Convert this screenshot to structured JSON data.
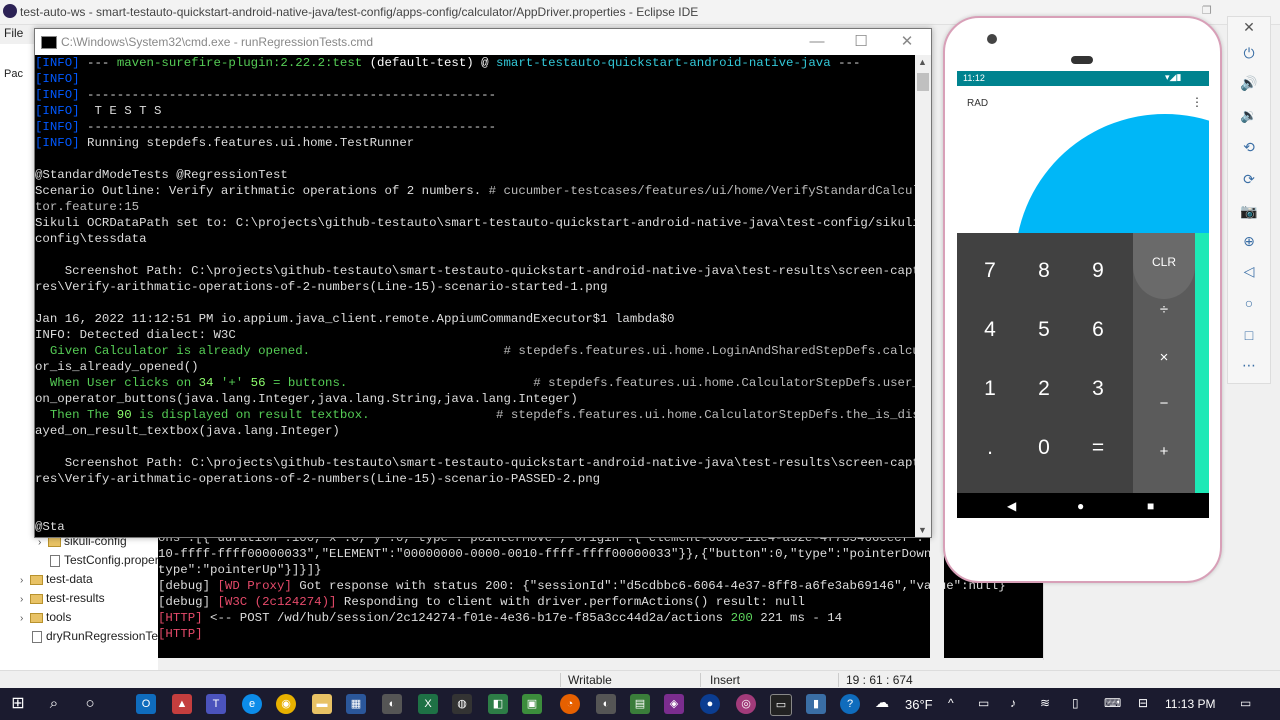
{
  "eclipse": {
    "title": "test-auto-ws - smart-testauto-quickstart-android-native-java/test-config/apps-config/calculator/AppDriver.properties - Eclipse IDE",
    "menu_file": "File",
    "panel_label": "Pac",
    "tree": [
      {
        "label": "sikuli-config",
        "type": "folder"
      },
      {
        "label": "TestConfig.proper",
        "type": "file"
      },
      {
        "label": "test-data",
        "type": "folder"
      },
      {
        "label": "test-results",
        "type": "folder"
      },
      {
        "label": "tools",
        "type": "folder"
      },
      {
        "label": "dryRunRegressionTes",
        "type": "file"
      }
    ],
    "console_lines": [
      {
        "text": "ons\":[{\"duration\":100,\"x\":0,\"y\":0,\"type\":\"pointerMove\",\"origin\":{\"element-6066-11e4-a52e-4f735466cecf\":\"000"
      },
      {
        "text": "10-ffff-ffff00000033\",\"ELEMENT\":\"00000000-0000-0010-ffff-ffff00000033\"}},{\"button\":0,\"type\":\"pointerDown\"},"
      },
      {
        "text": "type\":\"pointerUp\"}]}]}"
      }
    ],
    "log_lines": [
      {
        "tag": "[WD Proxy]",
        "msg": " Got response with status 200: {\"sessionId\":\"d5cdbbc6-6064-4e37-8ff8-a6fe3ab69146\",\"value\":null}"
      },
      {
        "tag": "[W3C (2c124274)]",
        "msg": " Responding to client with driver.performActions() result: null"
      }
    ],
    "debug_prefix": "[debug] ",
    "http_tag": "[HTTP]",
    "http_line": " <-- POST /wd/hub/session/2c124274-f01e-4e36-b17e-f85a3cc44d2a/actions ",
    "http_status": "200",
    "http_tail": " 221 ms - 14",
    "http_tag2": "[HTTP]",
    "status_writable": "Writable",
    "status_insert": "Insert",
    "status_pos": "19 : 61 : 674"
  },
  "cmd": {
    "title": "C:\\Windows\\System32\\cmd.exe - runRegressionTests.cmd",
    "info_tag": "[INFO]",
    "l1_a": " --- ",
    "l1_plugin": "maven-surefire-plugin:2.22.2:test",
    "l1_b": " (default-test) @ ",
    "l1_proj": "smart-testauto-quickstart-android-native-java",
    "l1_c": " ---",
    "dashes": " -------------------------------------------------------",
    "tests": "  T E S T S",
    "running": " Running stepdefs.features.ui.home.TestRunner",
    "tags": "@StandardModeTests @RegressionTest",
    "scenario_a": "Scenario Outline: Verify arithmatic operations of 2 numbers.",
    "scenario_b": " # cucumber-testcases/features/ui/home/VerifyStandardCalcula",
    "scenario_c": "tor.feature:15",
    "sikuli_a": "Sikuli OCRDataPath set to: C:\\projects\\github-testauto\\smart-testauto-quickstart-android-native-java\\test-config/sikuli-",
    "sikuli_b": "config\\tessdata",
    "ss1_a": "    Screenshot Path: C:\\projects\\github-testauto\\smart-testauto-quickstart-android-native-java\\test-results\\screen-captu",
    "ss1_b": "res\\Verify-arithmatic-operations-of-2-numbers(Line-15)-scenario-started-1.png",
    "date_line": "Jan 16, 2022 11:12:51 PM io.appium.java_client.remote.AppiumCommandExecutor$1 lambda$0",
    "dialect": "INFO: Detected dialect: W3C",
    "given_a": "  Given Calculator is already opened.",
    "given_b": "                          # stepdefs.features.ui.home.LoginAndSharedStepDefs.calculat",
    "given_c": "or_is_already_opened()",
    "when_a": "  When User clicks on ",
    "when_n1": "34",
    "when_mid": " '+' ",
    "when_n2": "56",
    "when_end": " = buttons.",
    "when_b": "                         # stepdefs.features.ui.home.CalculatorStepDefs.user_clicks_",
    "when_c": "on_operator_buttons(java.lang.Integer,java.lang.String,java.lang.Integer)",
    "then_a": "  Then The ",
    "then_n": "90",
    "then_end": " is displayed on result textbox.",
    "then_b": "                 # stepdefs.features.ui.home.CalculatorStepDefs.the_is_displ",
    "then_c": "ayed_on_result_textbox(java.lang.Integer)",
    "ss2_a": "    Screenshot Path: C:\\projects\\github-testauto\\smart-testauto-quickstart-android-native-java\\test-results\\screen-captu",
    "ss2_b": "res\\Verify-arithmatic-operations-of-2-numbers(Line-15)-scenario-PASSED-2.png",
    "last": "@Sta"
  },
  "emulator": {
    "status_time": "11:12",
    "mode": "RAD",
    "keys": [
      "7",
      "8",
      "9",
      "4",
      "5",
      "6",
      "1",
      "2",
      "3",
      ".",
      "0",
      "="
    ],
    "ops": [
      "CLR",
      "÷",
      "×",
      "−",
      "+"
    ]
  },
  "taskbar": {
    "temp": "36°F",
    "time": "11:13 PM"
  },
  "colors": {
    "accent_cyan": "#00b7f7",
    "teal": "#1de9b6",
    "statusbar": "#00838f"
  }
}
